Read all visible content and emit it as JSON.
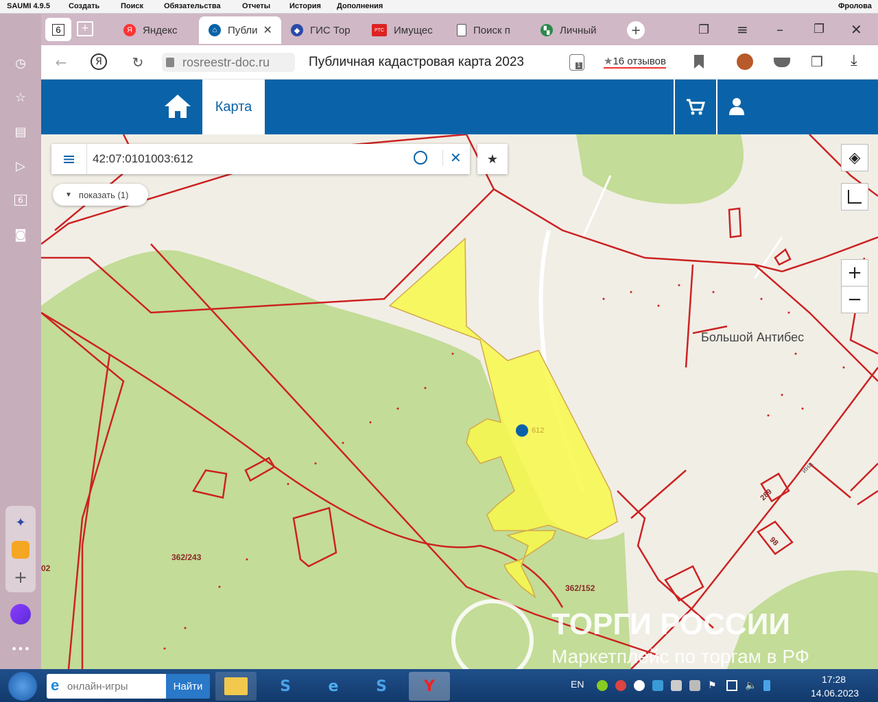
{
  "menubar": {
    "app": "SAUMI 4.9.5",
    "items": [
      "Создать",
      "Поиск",
      "Обязательства",
      "Отчеты",
      "История",
      "Дополнения"
    ],
    "user": "Фролова"
  },
  "tabs": [
    {
      "label": "Яндекс",
      "icon": "yandex-icon"
    },
    {
      "label": "Публи",
      "icon": "home-icon",
      "active": true
    },
    {
      "label": "ГИС Тор",
      "icon": "gis-icon"
    },
    {
      "label": "Имущес",
      "icon": "rts-icon",
      "badge": "PTC"
    },
    {
      "label": "Поиск п",
      "icon": "doc-icon"
    },
    {
      "label": "Личный",
      "icon": "cabinet-icon"
    }
  ],
  "tab_counter": "6",
  "address": {
    "domain": "rosreestr-doc.ru",
    "title": "Публичная кадастровая карта 2023",
    "reviews": "16 отзывов",
    "shield_count": "1"
  },
  "header": {
    "map_label": "Карта"
  },
  "search": {
    "value": "42:07:0101003:612",
    "show_label": "показать (1)"
  },
  "map": {
    "place": "Большой Антибес",
    "parcel_label": "612",
    "labels": [
      "362/243",
      "362/152",
      "02",
      "289",
      "98",
      "ина"
    ],
    "colors": {
      "parcel_fill": "#f8f84a",
      "boundary": "#cc2222",
      "forest": "#c3dc97",
      "land": "#f1eee6"
    }
  },
  "watermark": {
    "title": "ТОРГИ РОССИИ",
    "subtitle": "Маркетплейс по торгам в РФ"
  },
  "taskbar": {
    "search_placeholder": "онлайн-игры",
    "search_button": "Найти",
    "lang": "EN",
    "time": "17:28",
    "date": "14.06.2023"
  }
}
